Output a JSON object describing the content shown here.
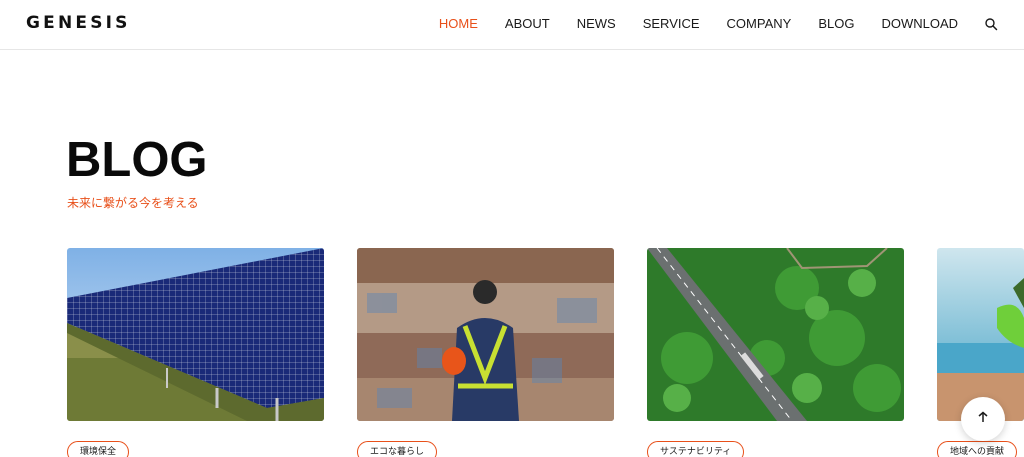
{
  "header": {
    "logo": "GENESIS",
    "nav": [
      {
        "label": "HOME",
        "active": true
      },
      {
        "label": "ABOUT",
        "active": false
      },
      {
        "label": "NEWS",
        "active": false
      },
      {
        "label": "SERVICE",
        "active": false
      },
      {
        "label": "COMPANY",
        "active": false
      },
      {
        "label": "BLOG",
        "active": false
      },
      {
        "label": "DOWNLOAD",
        "active": false
      }
    ],
    "search_icon": "search-icon"
  },
  "main": {
    "title": "BLOG",
    "subtitle": "未来に繋がる今を考える",
    "posts": [
      {
        "image": "solar-panels-photo",
        "tag": "環境保全"
      },
      {
        "image": "recycling-worker-photo",
        "tag": "エコな暮らし"
      },
      {
        "image": "aerial-forest-road-photo",
        "tag": "サステナビリティ"
      },
      {
        "image": "gloved-hand-seedling-photo",
        "tag": "地域への貢献"
      }
    ]
  },
  "scroll_top_icon": "arrow-up-icon",
  "colors": {
    "accent": "#e8501a",
    "text": "#1a1a1a",
    "border": "#e6e6e6"
  }
}
